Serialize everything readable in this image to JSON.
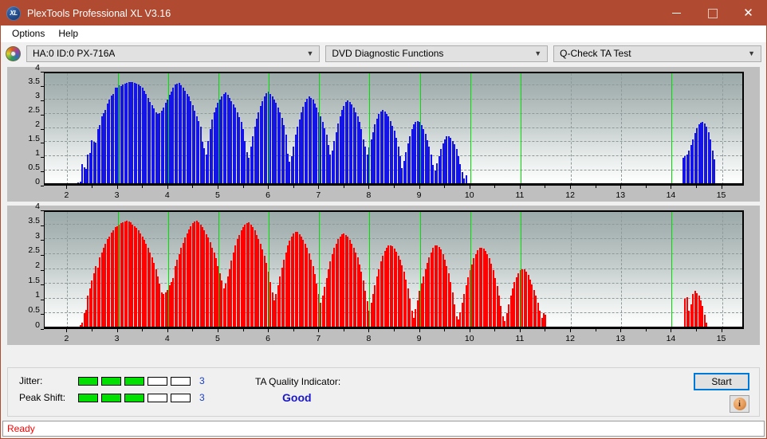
{
  "window": {
    "title": "PlexTools Professional XL V3.16",
    "icon": "xl-app-icon",
    "icon_text": "XL",
    "titlebar_color": "#b04b32",
    "minimize_label": "minimize-icon",
    "maximize_label": "maximize-icon",
    "close_label": "✕"
  },
  "menu": {
    "items": [
      {
        "label": "Options"
      },
      {
        "label": "Help"
      }
    ]
  },
  "toolbar": {
    "drive_icon": "disc-icon",
    "drive": {
      "value": "HA:0 ID:0  PX-716A",
      "chevron": "⌄"
    },
    "function": {
      "value": "DVD Diagnostic Functions",
      "chevron": "⌄"
    },
    "test": {
      "value": "Q-Check TA Test",
      "chevron": "⌄"
    }
  },
  "results": {
    "jitter": {
      "label": "Jitter:",
      "value": "3",
      "leds_total": 5,
      "leds_on": 3,
      "led_color": "#00e000"
    },
    "peak_shift": {
      "label": "Peak Shift:",
      "value": "3",
      "leds_total": 5,
      "leds_on": 3,
      "led_color": "#00e000"
    },
    "ta_quality": {
      "label": "TA Quality Indicator:",
      "value": "Good",
      "value_color": "#1a17c8"
    },
    "start_button": "Start",
    "info_button": "i"
  },
  "statusbar": {
    "text": "Ready",
    "color": "#ff0000"
  },
  "chart_data": [
    {
      "type": "bar",
      "title": "",
      "id": "jitter-chart",
      "color": "#1414e6",
      "edge_color": "#000080",
      "xlabel": "",
      "ylabel": "",
      "xlim": [
        1.55,
        15.45
      ],
      "ylim": [
        0,
        4
      ],
      "yticks": [
        0,
        0.5,
        1,
        1.5,
        2,
        2.5,
        3,
        3.5,
        4
      ],
      "ytick_labels": [
        "0",
        "0.5",
        "1",
        "1.5",
        "2",
        "2.5",
        "3",
        "3.5",
        "4"
      ],
      "xticks": [
        2,
        3,
        4,
        5,
        6,
        7,
        8,
        9,
        10,
        11,
        12,
        13,
        14,
        15
      ],
      "xtick_labels": [
        "2",
        "3",
        "4",
        "5",
        "6",
        "7",
        "8",
        "9",
        "10",
        "11",
        "12",
        "13",
        "14",
        "15"
      ],
      "grid": true,
      "markers": [
        3,
        4,
        5,
        6,
        7,
        8,
        9,
        10,
        11,
        14
      ],
      "marker_color": "#00e000",
      "bar_start": 2.22,
      "bar_step": 0.0385,
      "values": [
        0.08,
        0.12,
        0.72,
        0.62,
        0.55,
        1.05,
        1.12,
        1.58,
        1.5,
        1.48,
        1.95,
        2.1,
        2.42,
        2.52,
        2.62,
        2.85,
        2.98,
        3.12,
        3.2,
        3.4,
        3.42,
        3.5,
        3.46,
        3.52,
        3.55,
        3.58,
        3.6,
        3.62,
        3.6,
        3.58,
        3.56,
        3.52,
        3.48,
        3.4,
        3.3,
        3.2,
        3.05,
        2.92,
        2.8,
        2.68,
        2.55,
        2.48,
        2.52,
        2.6,
        2.72,
        2.88,
        3.0,
        3.15,
        3.28,
        3.4,
        3.52,
        3.56,
        3.58,
        3.5,
        3.4,
        3.3,
        3.2,
        3.1,
        2.95,
        2.8,
        2.6,
        2.4,
        2.25,
        2.05,
        1.5,
        1.3,
        1.05,
        1.55,
        1.95,
        2.3,
        2.55,
        2.72,
        2.88,
        3.0,
        3.1,
        3.2,
        3.25,
        3.15,
        3.05,
        2.95,
        2.82,
        2.7,
        2.55,
        2.38,
        2.2,
        1.95,
        1.55,
        1.15,
        0.95,
        1.35,
        1.72,
        2.05,
        2.32,
        2.55,
        2.78,
        2.95,
        3.1,
        3.22,
        3.26,
        3.2,
        3.1,
        3.0,
        2.88,
        2.72,
        2.55,
        2.35,
        2.1,
        1.75,
        1.1,
        0.8,
        1.0,
        1.35,
        1.75,
        2.05,
        2.3,
        2.55,
        2.75,
        2.9,
        3.02,
        3.1,
        3.06,
        2.98,
        2.85,
        2.72,
        2.55,
        2.4,
        2.2,
        2.0,
        1.75,
        1.4,
        1.05,
        1.2,
        1.55,
        1.85,
        2.15,
        2.4,
        2.62,
        2.78,
        2.9,
        2.96,
        2.92,
        2.82,
        2.7,
        2.55,
        2.4,
        2.2,
        1.95,
        1.6,
        1.35,
        1.05,
        1.32,
        1.6,
        1.85,
        2.12,
        2.32,
        2.48,
        2.58,
        2.62,
        2.58,
        2.5,
        2.4,
        2.25,
        2.08,
        1.9,
        1.65,
        1.35,
        1.0,
        0.6,
        0.85,
        1.15,
        1.45,
        1.7,
        1.95,
        2.12,
        2.22,
        2.25,
        2.2,
        2.1,
        1.95,
        1.78,
        1.58,
        1.35,
        1.05,
        0.7,
        0.5,
        0.75,
        1.0,
        1.25,
        1.45,
        1.6,
        1.7,
        1.72,
        1.65,
        1.55,
        1.42,
        1.25,
        1.0,
        0.72,
        0.45,
        0.22,
        0.35,
        0.0,
        0.0,
        0.0,
        0.0,
        0.0,
        0.0,
        0.0,
        0.0,
        0.0,
        0.0,
        0.0,
        0.0,
        0.0,
        0.0,
        0.0,
        0.0,
        0.0,
        0.0,
        0.0,
        0.0,
        0.0,
        0.0,
        0.0,
        0.0,
        0.0,
        0.0,
        0.0,
        0.0,
        0.0,
        0.0,
        0.0,
        0.0,
        0.0,
        0.0,
        0.0,
        0.0,
        0.0,
        0.0,
        0.0,
        0.0,
        0.0,
        0.0,
        0.0,
        0.0,
        0.0,
        0.0,
        0.0,
        0.0,
        0.0,
        0.0,
        0.0,
        0.0,
        0.0,
        0.0,
        0.0,
        0.0,
        0.0,
        0.0,
        0.0,
        0.0,
        0.0,
        0.0,
        0.0,
        0.0,
        0.0,
        0.0,
        0.0,
        0.0,
        0.0,
        0.0,
        0.0,
        0.0,
        0.0,
        0.0,
        0.0,
        0.0,
        0.0,
        0.0,
        0.0,
        0.0,
        0.0,
        0.0,
        0.0,
        0.0,
        0.0,
        0.0,
        0.0,
        0.0,
        0.0,
        0.0,
        0.0,
        0.0,
        0.0,
        0.0,
        0.0,
        0.0,
        0.0,
        0.0,
        0.0,
        0.0,
        0.0,
        0.0,
        0.0,
        0.0,
        0.0,
        0.0,
        0.0,
        0.0,
        0.0,
        0.0,
        0.0,
        0.95,
        1.0,
        1.05,
        1.2,
        1.4,
        1.6,
        1.82,
        2.0,
        2.12,
        2.18,
        2.2,
        2.15,
        2.05,
        1.85,
        1.6,
        1.2,
        0.9,
        0.0,
        0.0,
        0.0,
        0.0,
        0.0,
        0.0,
        0.0,
        0.0,
        0.0,
        0.0,
        0.0,
        0.0,
        0.0,
        0.0,
        0.0,
        0.0,
        0.0,
        0.0,
        0.0,
        0.0,
        0.0
      ]
    },
    {
      "type": "bar",
      "title": "",
      "id": "peak-shift-chart",
      "color": "#ff0000",
      "edge_color": "#c00000",
      "xlabel": "",
      "ylabel": "",
      "xlim": [
        1.55,
        15.45
      ],
      "ylim": [
        0,
        4
      ],
      "yticks": [
        0,
        0.5,
        1,
        1.5,
        2,
        2.5,
        3,
        3.5,
        4
      ],
      "ytick_labels": [
        "0",
        "0.5",
        "1",
        "1.5",
        "2",
        "2.5",
        "3",
        "3.5",
        "4"
      ],
      "xticks": [
        2,
        3,
        4,
        5,
        6,
        7,
        8,
        9,
        10,
        11,
        12,
        13,
        14,
        15
      ],
      "xtick_labels": [
        "2",
        "3",
        "4",
        "5",
        "6",
        "7",
        "8",
        "9",
        "10",
        "11",
        "12",
        "13",
        "14",
        "15"
      ],
      "grid": true,
      "markers": [
        3,
        4,
        5,
        6,
        7,
        8,
        9,
        10,
        11,
        14
      ],
      "marker_color": "#00e000",
      "bar_start": 2.22,
      "bar_step": 0.0385,
      "values": [
        0.05,
        0.1,
        0.18,
        0.5,
        0.62,
        1.1,
        1.35,
        1.6,
        1.85,
        2.1,
        2.05,
        2.38,
        2.55,
        2.7,
        2.85,
        3.0,
        3.1,
        3.22,
        3.3,
        3.4,
        3.45,
        3.5,
        3.55,
        3.58,
        3.6,
        3.62,
        3.6,
        3.56,
        3.5,
        3.45,
        3.38,
        3.3,
        3.2,
        3.1,
        2.98,
        2.85,
        2.7,
        2.55,
        2.4,
        2.2,
        2.0,
        1.75,
        1.5,
        1.2,
        1.15,
        1.2,
        1.3,
        1.45,
        1.55,
        1.7,
        2.1,
        2.3,
        2.5,
        2.7,
        2.88,
        3.05,
        3.2,
        3.32,
        3.45,
        3.55,
        3.6,
        3.62,
        3.58,
        3.5,
        3.4,
        3.3,
        3.18,
        3.05,
        2.9,
        2.72,
        2.55,
        2.35,
        2.1,
        1.85,
        1.6,
        1.35,
        1.5,
        1.75,
        2.0,
        2.28,
        2.55,
        2.8,
        3.0,
        3.15,
        3.3,
        3.42,
        3.5,
        3.55,
        3.56,
        3.5,
        3.4,
        3.3,
        3.15,
        3.0,
        2.85,
        2.65,
        2.45,
        2.2,
        1.9,
        1.55,
        1.2,
        0.95,
        1.15,
        1.45,
        1.75,
        2.05,
        2.32,
        2.55,
        2.78,
        2.95,
        3.1,
        3.2,
        3.26,
        3.24,
        3.18,
        3.1,
        2.98,
        2.85,
        2.7,
        2.52,
        2.32,
        2.1,
        1.82,
        1.5,
        1.15,
        0.85,
        1.1,
        1.4,
        1.7,
        2.0,
        2.25,
        2.5,
        2.7,
        2.85,
        3.0,
        3.1,
        3.18,
        3.2,
        3.15,
        3.08,
        2.98,
        2.85,
        2.72,
        2.55,
        2.38,
        2.15,
        1.9,
        1.6,
        1.25,
        0.9,
        0.6,
        0.85,
        1.15,
        1.45,
        1.75,
        2.0,
        2.25,
        2.45,
        2.6,
        2.7,
        2.78,
        2.8,
        2.76,
        2.68,
        2.58,
        2.45,
        2.3,
        2.12,
        1.9,
        1.65,
        1.35,
        1.0,
        0.6,
        0.35,
        0.65,
        0.95,
        1.25,
        1.5,
        1.75,
        1.98,
        2.2,
        2.4,
        2.55,
        2.7,
        2.78,
        2.8,
        2.75,
        2.65,
        2.5,
        2.32,
        2.1,
        1.85,
        1.55,
        1.2,
        0.8,
        0.4,
        0.3,
        0.55,
        0.85,
        1.15,
        1.45,
        1.72,
        1.95,
        2.15,
        2.35,
        2.5,
        2.62,
        2.7,
        2.72,
        2.68,
        2.6,
        2.5,
        2.35,
        2.18,
        1.95,
        1.7,
        1.42,
        1.1,
        0.75,
        0.4,
        0.25,
        0.5,
        0.8,
        1.1,
        1.35,
        1.55,
        1.72,
        1.85,
        1.95,
        2.0,
        1.98,
        1.9,
        1.8,
        1.65,
        1.48,
        1.3,
        1.1,
        0.85,
        0.6,
        0.35,
        0.5,
        0.45,
        0.0,
        0.0,
        0.0,
        0.0,
        0.0,
        0.0,
        0.0,
        0.0,
        0.0,
        0.0,
        0.0,
        0.0,
        0.0,
        0.0,
        0.0,
        0.0,
        0.0,
        0.0,
        0.0,
        0.0,
        0.0,
        0.0,
        0.0,
        0.0,
        0.0,
        0.0,
        0.0,
        0.0,
        0.0,
        0.0,
        0.0,
        0.0,
        0.0,
        0.0,
        0.0,
        0.0,
        0.0,
        0.0,
        0.0,
        0.0,
        0.0,
        0.0,
        0.0,
        0.0,
        0.0,
        0.0,
        0.0,
        0.0,
        0.0,
        0.0,
        0.0,
        0.0,
        0.0,
        0.0,
        0.0,
        0.0,
        0.0,
        0.0,
        0.0,
        0.0,
        0.0,
        0.0,
        0.0,
        0.0,
        0.0,
        0.0,
        0.0,
        0.0,
        0.0,
        0.0,
        0.0,
        1.0,
        1.05,
        0.6,
        0.8,
        1.15,
        1.25,
        1.18,
        1.1,
        0.95,
        0.75,
        0.45,
        0.2,
        0.0,
        0.0,
        0.0,
        0.0,
        0.0,
        0.0,
        0.0,
        0.0,
        0.0,
        0.0,
        0.0,
        0.0,
        0.0,
        0.0,
        0.0,
        0.0,
        0.0,
        0.0,
        0.0,
        0.0,
        0.0,
        0.0,
        0.0,
        0.0,
        0.0
      ]
    }
  ]
}
